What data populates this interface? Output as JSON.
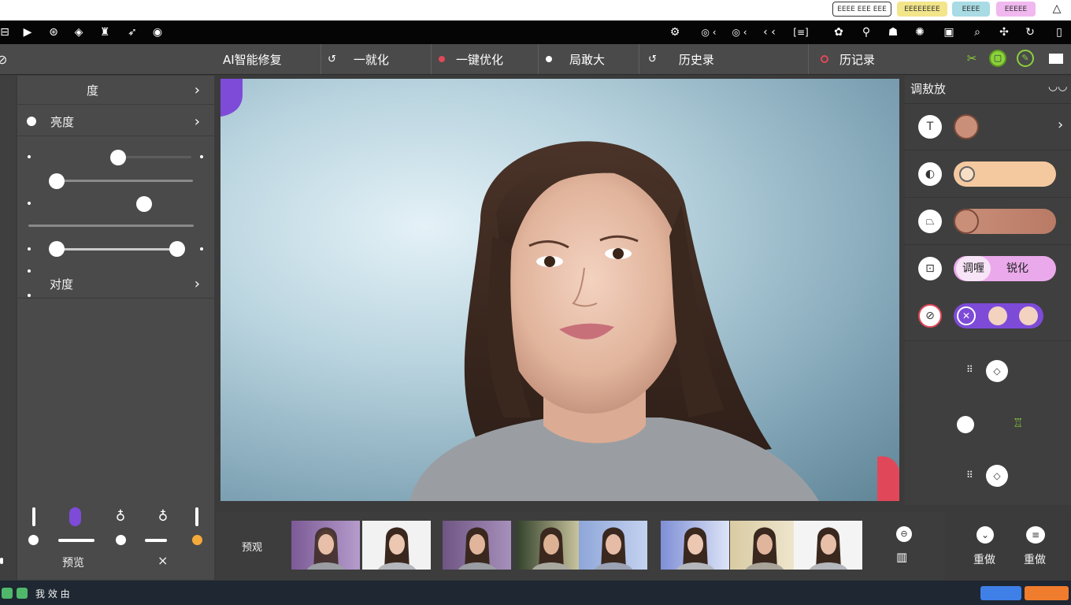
{
  "top_pills": [
    {
      "label": "EEEE EEE EEE",
      "bg": "#ffffff",
      "border": "#333333"
    },
    {
      "label": "EEEEEEEE",
      "bg": "#f3e58a",
      "border": "#e3d060"
    },
    {
      "label": "EEEE",
      "bg": "#a8dbe4",
      "border": "#86c4cf"
    },
    {
      "label": "EEEEE",
      "bg": "#f1b8ef",
      "border": "#e09add"
    }
  ],
  "menu": {
    "items": [
      {
        "label": "AI智能修复"
      },
      {
        "label": "一就化"
      },
      {
        "label": "一键优化"
      },
      {
        "label": "局敢大"
      },
      {
        "label": "历史录"
      },
      {
        "label": "历记录"
      }
    ]
  },
  "left_panel": {
    "header": "度",
    "brightness_label": "亮度",
    "contrast_label": "对度",
    "preview_label": "预览",
    "close_label": "×"
  },
  "right_panel": {
    "title": "调敖放",
    "adjust_label": "调喱",
    "sharpen_label": "锐化"
  },
  "filmstrip": {
    "label": "预观",
    "redo_label": "重做",
    "undo_label": "重做"
  },
  "statusbar": {
    "text": "我 效 由"
  },
  "colors": {
    "accent_purple": "#7d4bd8",
    "accent_red": "#e0485a",
    "accent_green": "#8bd13a",
    "accent_orange": "#f4a93b",
    "skin_peach": "#f4c9a0",
    "pink": "#eaa9ea"
  }
}
